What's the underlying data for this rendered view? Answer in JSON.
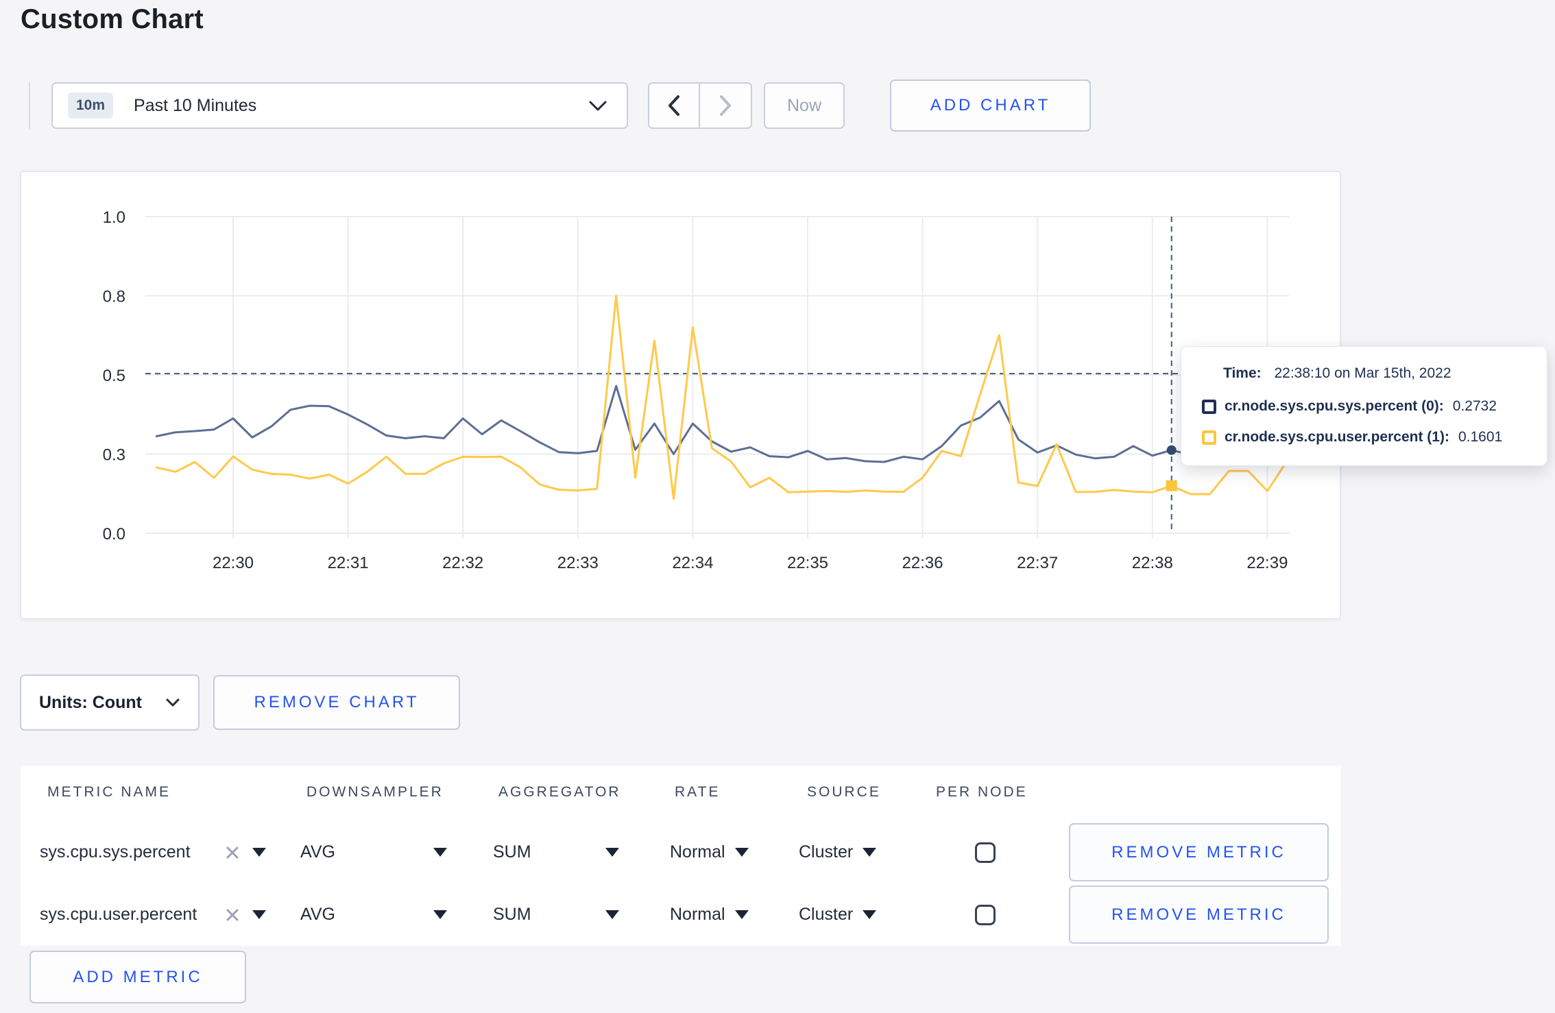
{
  "page": {
    "title": "Custom Chart"
  },
  "toolbar": {
    "time_range": {
      "badge": "10m",
      "label": "Past 10 Minutes"
    },
    "now_label": "Now",
    "add_chart_label": "ADD CHART"
  },
  "tooltip": {
    "time_label": "Time:",
    "time_value": "22:38:10 on Mar 15th, 2022",
    "rows": [
      {
        "label": "cr.node.sys.cpu.sys.percent (0):",
        "value": "0.2732",
        "swatch_color": "#1e2f54"
      },
      {
        "label": "cr.node.sys.cpu.user.percent (1):",
        "value": "0.1601",
        "swatch_color": "#fcc53d"
      }
    ]
  },
  "chart_controls": {
    "units_label": "Units: Count",
    "remove_chart_label": "REMOVE CHART"
  },
  "metrics_table": {
    "headers": [
      "METRIC NAME",
      "DOWNSAMPLER",
      "AGGREGATOR",
      "RATE",
      "SOURCE",
      "PER NODE"
    ],
    "rows": [
      {
        "metric": "sys.cpu.sys.percent",
        "downsampler": "AVG",
        "aggregator": "SUM",
        "rate": "Normal",
        "source": "Cluster",
        "per_node_checked": false,
        "remove_label": "REMOVE METRIC"
      },
      {
        "metric": "sys.cpu.user.percent",
        "downsampler": "AVG",
        "aggregator": "SUM",
        "rate": "Normal",
        "source": "Cluster",
        "per_node_checked": false,
        "remove_label": "REMOVE METRIC"
      }
    ],
    "add_metric_label": "ADD METRIC"
  },
  "chart_data": {
    "type": "line",
    "title": "",
    "xlabel": "",
    "ylabel": "",
    "grid": true,
    "y_ticks": [
      0.0,
      0.3,
      0.5,
      0.8,
      1.0
    ],
    "y_tick_labels": [
      "0.0",
      "0.3",
      "0.5",
      "0.8",
      "1.0"
    ],
    "x_tick_labels": [
      "22:30",
      "22:31",
      "22:32",
      "22:33",
      "22:34",
      "22:35",
      "22:36",
      "22:37",
      "22:38",
      "22:39"
    ],
    "x_times": [
      "22:29:20",
      "22:29:30",
      "22:29:40",
      "22:29:50",
      "22:30:00",
      "22:30:10",
      "22:30:20",
      "22:30:30",
      "22:30:40",
      "22:30:50",
      "22:31:00",
      "22:31:10",
      "22:31:20",
      "22:31:30",
      "22:31:40",
      "22:31:50",
      "22:32:00",
      "22:32:10",
      "22:32:20",
      "22:32:30",
      "22:32:40",
      "22:32:50",
      "22:33:00",
      "22:33:10",
      "22:33:20",
      "22:33:30",
      "22:33:40",
      "22:33:50",
      "22:34:00",
      "22:34:10",
      "22:34:20",
      "22:34:30",
      "22:34:40",
      "22:34:50",
      "22:35:00",
      "22:35:10",
      "22:35:20",
      "22:35:30",
      "22:35:40",
      "22:35:50",
      "22:36:00",
      "22:36:10",
      "22:36:20",
      "22:36:30",
      "22:36:40",
      "22:36:50",
      "22:37:00",
      "22:37:10",
      "22:37:20",
      "22:37:30",
      "22:37:40",
      "22:37:50",
      "22:38:00",
      "22:38:10",
      "22:38:20",
      "22:38:30",
      "22:38:40",
      "22:38:50",
      "22:39:00",
      "22:39:10"
    ],
    "series": [
      {
        "name": "cr.node.sys.cpu.sys.percent",
        "color": "#5c6e92",
        "values": [
          0.345,
          0.355,
          0.358,
          0.362,
          0.39,
          0.342,
          0.37,
          0.412,
          0.422,
          0.421,
          0.4,
          0.375,
          0.347,
          0.34,
          0.345,
          0.34,
          0.39,
          0.35,
          0.385,
          0.358,
          0.33,
          0.305,
          0.302,
          0.308,
          0.472,
          0.311,
          0.377,
          0.3,
          0.377,
          0.332,
          0.306,
          0.317,
          0.292,
          0.288,
          0.308,
          0.28,
          0.285,
          0.273,
          0.27,
          0.29,
          0.28,
          0.32,
          0.372,
          0.392,
          0.434,
          0.337,
          0.304,
          0.322,
          0.298,
          0.284,
          0.29,
          0.32,
          0.294,
          0.31,
          0.297,
          0.3,
          0.302,
          0.298,
          0.3,
          0.301
        ]
      },
      {
        "name": "cr.node.sys.cpu.user.percent",
        "color": "#ffc94a",
        "values": [
          0.249,
          0.233,
          0.27,
          0.21,
          0.291,
          0.241,
          0.225,
          0.222,
          0.207,
          0.222,
          0.188,
          0.233,
          0.29,
          0.225,
          0.225,
          0.265,
          0.29,
          0.289,
          0.29,
          0.25,
          0.185,
          0.165,
          0.162,
          0.168,
          0.8,
          0.21,
          0.63,
          0.13,
          0.68,
          0.315,
          0.272,
          0.174,
          0.21,
          0.155,
          0.158,
          0.16,
          0.157,
          0.162,
          0.158,
          0.157,
          0.21,
          0.308,
          0.292,
          0.45,
          0.651,
          0.192,
          0.179,
          0.325,
          0.156,
          0.157,
          0.164,
          0.158,
          0.155,
          0.18,
          0.148,
          0.148,
          0.236,
          0.236,
          0.16,
          0.27
        ]
      }
    ],
    "crosshair": {
      "time": "22:38:10",
      "hline_value": 0.505,
      "markers": [
        {
          "series": 0,
          "value": 0.31,
          "color": "#344a70"
        },
        {
          "series": 1,
          "value": 0.18,
          "color": "#fcc53d"
        }
      ]
    }
  },
  "colors": {
    "accent": "#2553f0",
    "navy": "#1e2f54",
    "grid": "#ececee",
    "crosshair": "#3d5982"
  }
}
